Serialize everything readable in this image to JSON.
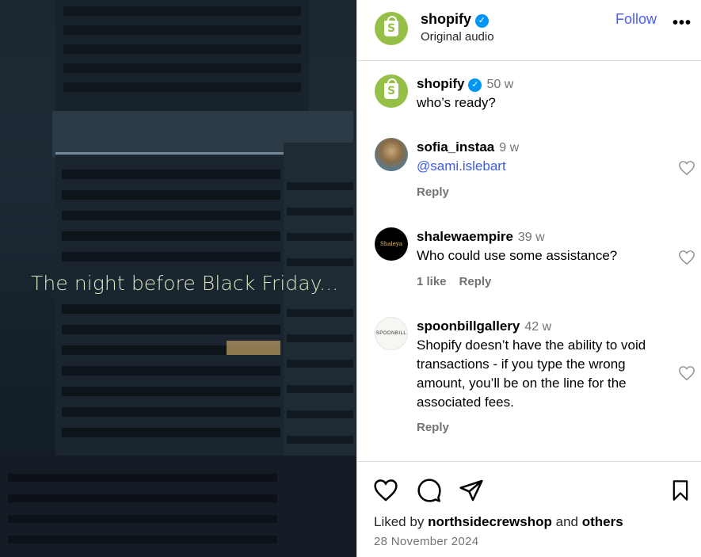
{
  "media": {
    "caption": "The night before Black Friday..."
  },
  "header": {
    "username": "shopify",
    "subtitle": "Original audio",
    "follow_label": "Follow",
    "more_label": "•••"
  },
  "post": {
    "username": "shopify",
    "time": "50 w",
    "text": "who’s ready?"
  },
  "comments": [
    {
      "username": "sofia_instaa",
      "time": "9 w",
      "text": "@sami.islebart",
      "reply_label": "Reply"
    },
    {
      "username": "shalewaempire",
      "time": "39 w",
      "text": "Who could use some assistance?",
      "likes_label": "1 like",
      "reply_label": "Reply",
      "avatar_text": "Shaleya"
    },
    {
      "username": "spoonbillgallery",
      "time": "42 w",
      "text": "Shopify doesn’t have the ability to void transactions - if you type the wrong amount, you’ll be on the line for the associated fees.",
      "reply_label": "Reply",
      "avatar_text": "SPOONBILL"
    }
  ],
  "footer": {
    "liked_prefix": "Liked by",
    "liked_user": "northsidecrewshop",
    "liked_and": "and",
    "liked_others": "others",
    "date": "28 November 2024"
  },
  "colors": {
    "accent": "#4a5df9",
    "verified": "#0095f6",
    "shopify_green": "#95bf47"
  }
}
